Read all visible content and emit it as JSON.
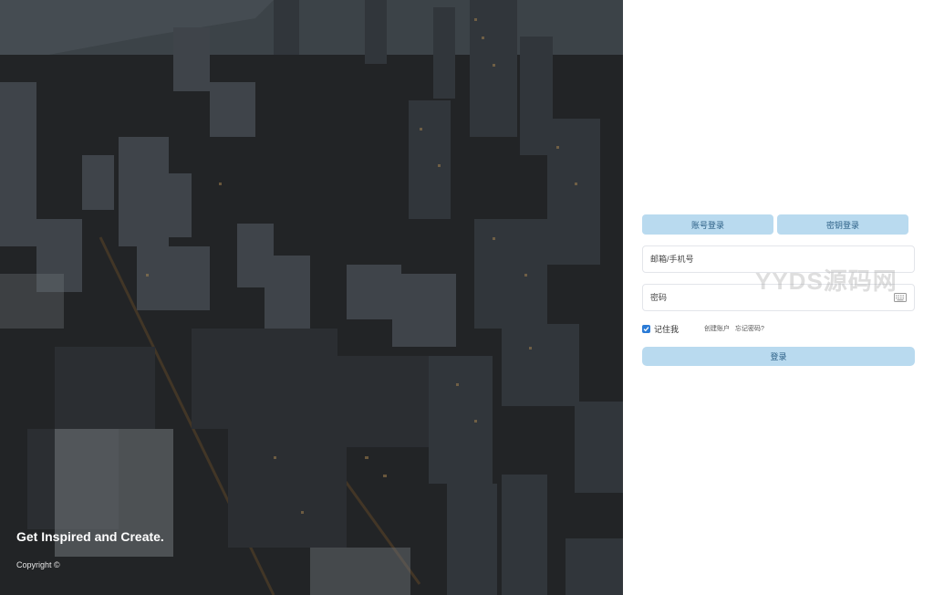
{
  "hero": {
    "title": "Get Inspired and Create.",
    "copyright": "Copyright ©"
  },
  "tabs": [
    {
      "label": "账号登录"
    },
    {
      "label": "密钥登录"
    }
  ],
  "form": {
    "username_placeholder": "邮箱/手机号",
    "password_placeholder": "密码",
    "remember_label": "记住我",
    "remember_checked": true,
    "create_account": "创建账户",
    "forgot_password": "忘记密码?",
    "submit_label": "登录"
  },
  "watermark": "YYDS源码网",
  "colors": {
    "tab_bg": "#b9daef",
    "tab_text": "#2b5f86",
    "checkbox": "#2b7bd6"
  }
}
